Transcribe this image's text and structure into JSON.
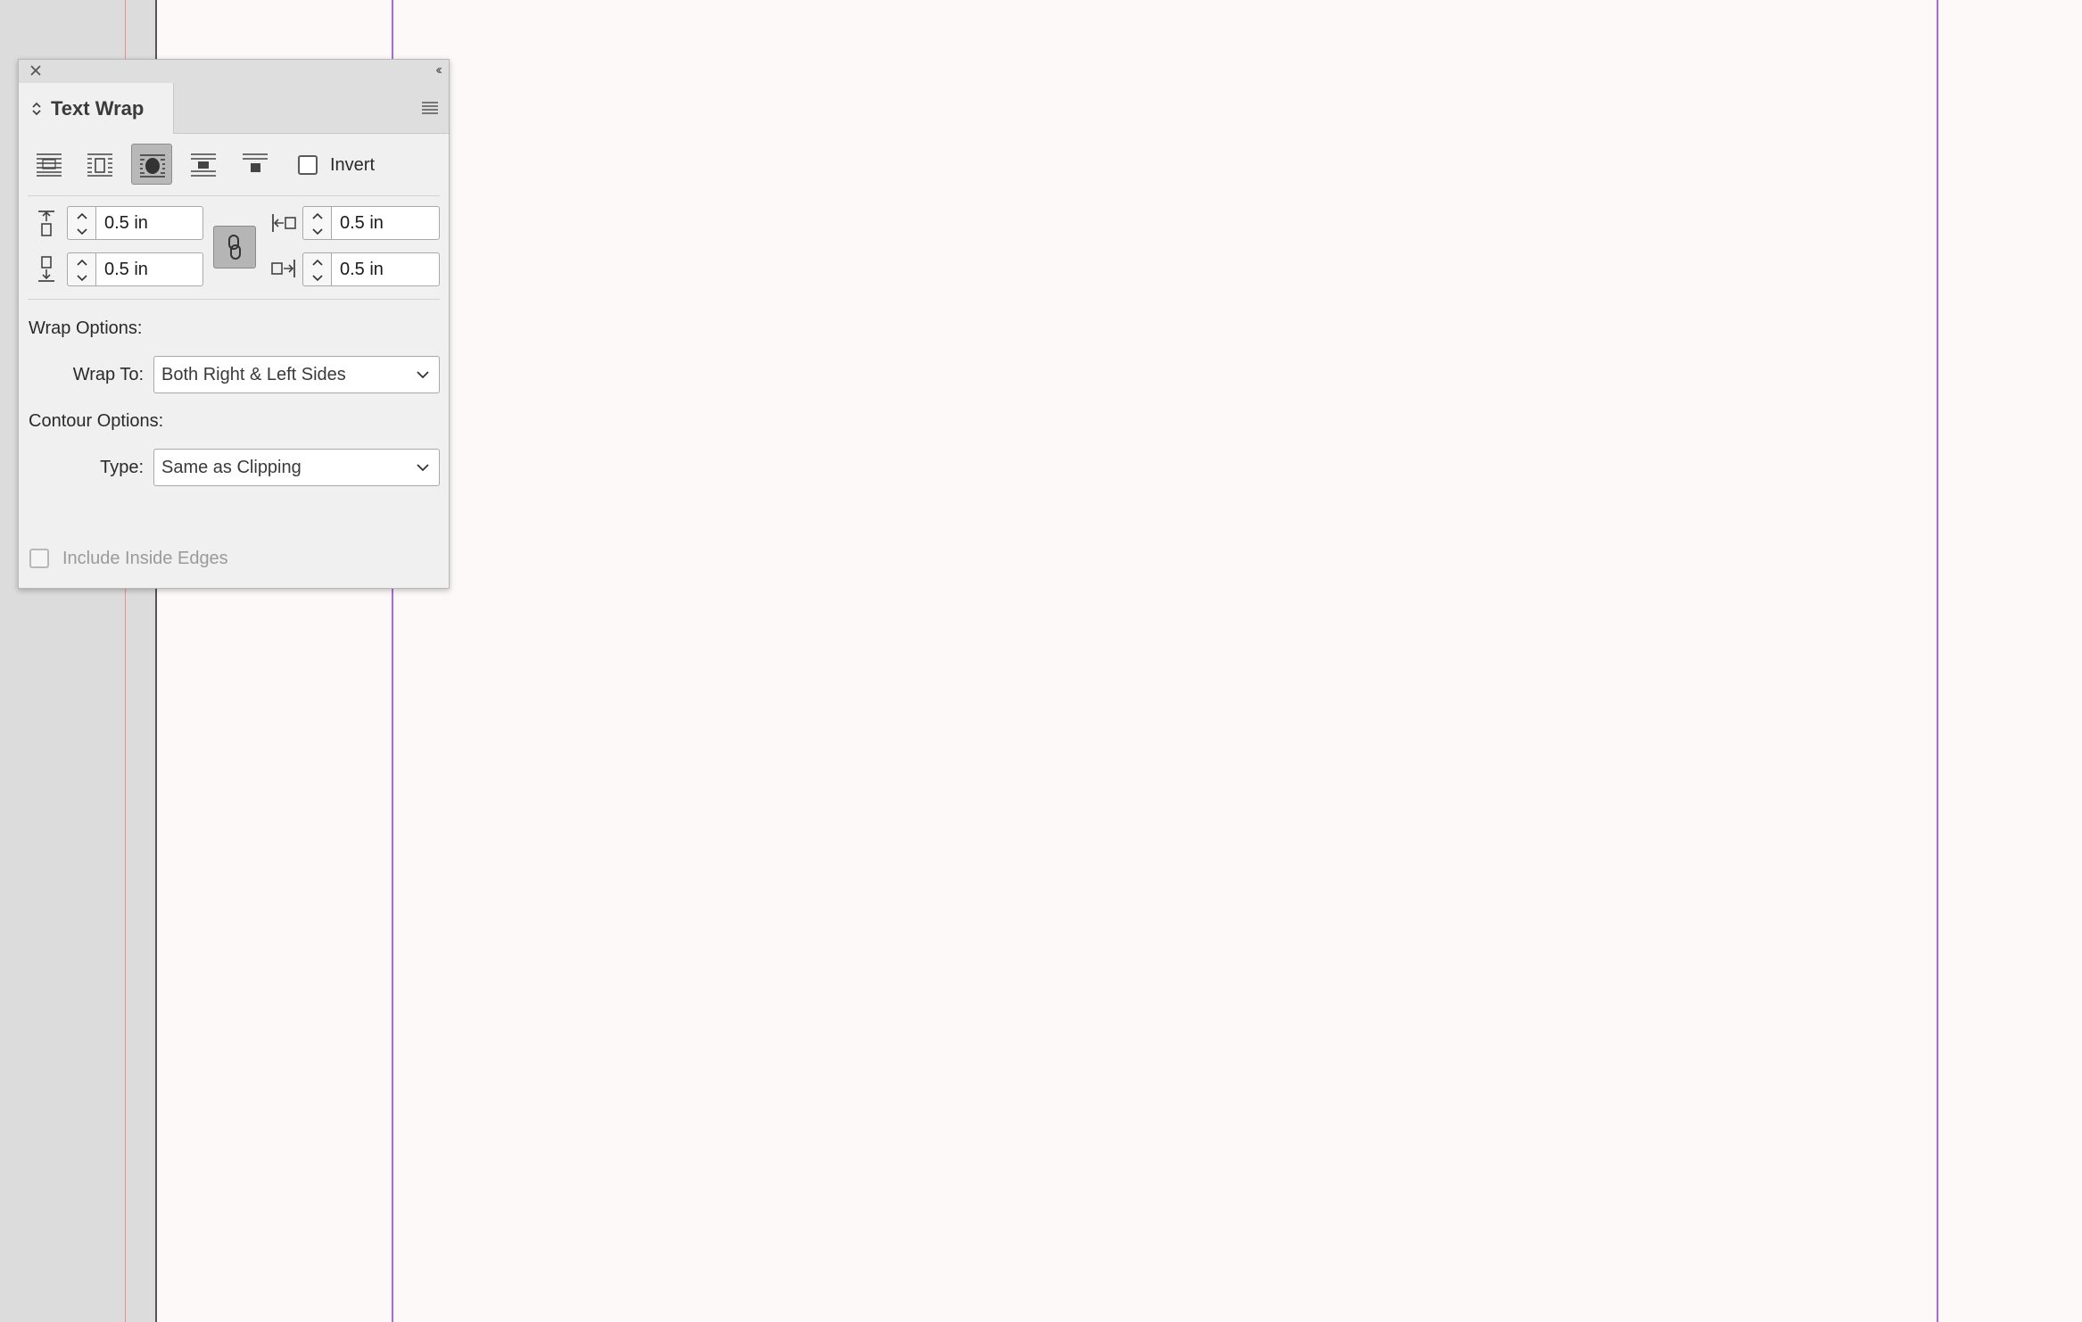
{
  "panel": {
    "title": "Text Wrap",
    "icons": {
      "close": "close-icon",
      "collapse": "double-chevron-left-icon",
      "menu": "panel-menu-icon",
      "tab_arrows": "up-down-arrows-icon"
    },
    "collapse_glyph": "‹‹",
    "wrap_modes": [
      {
        "name": "no-text-wrap",
        "selected": false
      },
      {
        "name": "wrap-around-bounding-box",
        "selected": false
      },
      {
        "name": "wrap-around-object-shape",
        "selected": true
      },
      {
        "name": "jump-object",
        "selected": false
      },
      {
        "name": "jump-to-next-column",
        "selected": false
      }
    ],
    "invert": {
      "label": "Invert",
      "checked": false
    },
    "offsets": {
      "top": "0.5 in",
      "bottom": "0.5 in",
      "left": "0.5 in",
      "right": "0.5 in"
    },
    "wrap_options": {
      "heading": "Wrap Options:",
      "wrap_to_label": "Wrap To:",
      "wrap_to_value": "Both Right & Left Sides"
    },
    "contour_options": {
      "heading": "Contour Options:",
      "type_label": "Type:",
      "type_value": "Same as Clipping"
    },
    "include_inside_edges": {
      "label": "Include Inside Edges",
      "checked": false,
      "enabled": false
    }
  },
  "colors": {
    "bleed_guide": "#e88f8f",
    "margin_guide": "#a66ae8",
    "pasteboard": "#dcdcdc",
    "page": "#fdf9f8",
    "selected_button": "#b8b8b8"
  }
}
